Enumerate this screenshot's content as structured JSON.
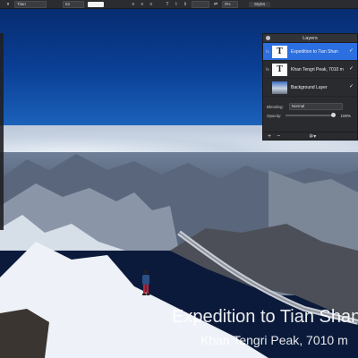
{
  "toolbar": {
    "font_family": "Titan",
    "font_size": "62",
    "zoom": "0%",
    "styles_label": "Styles"
  },
  "layers_panel": {
    "title": "Layers",
    "layers": [
      {
        "name": "Expedition to Tian Shan",
        "kind": "text",
        "thumb": "T",
        "fx": "fx",
        "visible": true,
        "selected": true
      },
      {
        "name": "Khan Tengri  Peak, 7010 m",
        "kind": "text",
        "thumb": "T",
        "fx": "fx",
        "visible": true,
        "selected": false
      },
      {
        "name": "Background Layer",
        "kind": "image",
        "thumb": "",
        "fx": "",
        "visible": true,
        "selected": false
      }
    ],
    "blending_label": "Blending:",
    "blending_value": "Normal",
    "opacity_label": "Opacity:",
    "opacity_value": "100%",
    "footer": {
      "add": "+",
      "remove": "−"
    }
  },
  "canvas_text": {
    "title": "Expedition to Tian Shan",
    "subtitle": "Khan Tengri  Peak, 7010 m"
  },
  "colors": {
    "selection": "#2c6fe0",
    "panel_bg": "#2a2b2e"
  }
}
